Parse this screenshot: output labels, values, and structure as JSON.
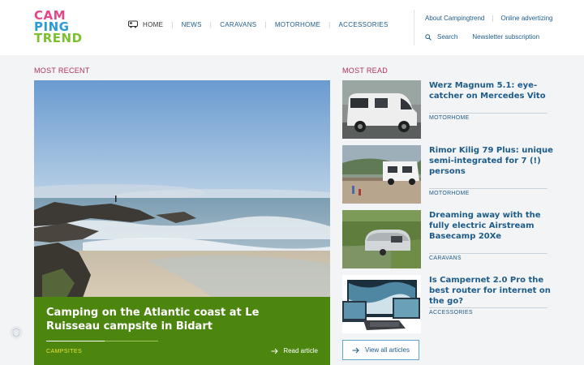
{
  "logo": {
    "line1_a": "CAM",
    "line1_b": "",
    "line2": "PING",
    "line3": "TREND"
  },
  "nav": {
    "home": "HOME",
    "news": "NEWS",
    "caravans": "CARAVANS",
    "motorhome": "MOTORHOME",
    "accessories": "ACCESSORIES"
  },
  "utility": {
    "about": "About Campingtrend",
    "advertising": "Online advertizing",
    "search": "Search",
    "newsletter": "Newsletter subscription"
  },
  "sections": {
    "most_recent": "MOST RECENT",
    "most_read": "MOST READ"
  },
  "hero": {
    "title": "Camping on the Atlantic coast at Le Ruisseau campsite in Bidart",
    "category": "CAMPSITES",
    "read": "Read article"
  },
  "most_read": [
    {
      "title": "Werz Magnum 5.1: eye-catcher on Mercedes Vito",
      "category": "MOTORHOME"
    },
    {
      "title": "Rimor Kilig 79 Plus: unique semi-integrated for 7 (!) persons",
      "category": "MOTORHOME"
    },
    {
      "title": "Dreaming away with the fully electric Airstream Basecamp 20Xe",
      "category": "CARAVANS"
    },
    {
      "title": "Is Campernet 2.0 Pro the best router for internet on the go?",
      "category": "ACCESSORIES"
    }
  ],
  "view_all": "View all articles",
  "colors": {
    "accent": "#b0305c",
    "link": "#1d5c8a",
    "hero_caption": "#4c860f"
  }
}
